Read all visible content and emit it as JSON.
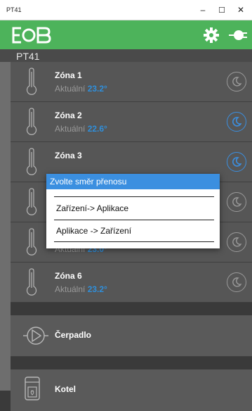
{
  "window": {
    "title": "PT41",
    "minimize": "–",
    "maximize": "☐",
    "close": "✕"
  },
  "header": {
    "logo_icon": "ebb-logo",
    "settings_icon": "gear-icon",
    "connect_icon": "plug-icon"
  },
  "subheader": {
    "title": "PT41"
  },
  "zones": [
    {
      "name": "Zóna 1",
      "label": "Aktuální",
      "temp": "23.2°",
      "mode_icon": "moon-icon",
      "active": false
    },
    {
      "name": "Zóna 2",
      "label": "Aktuální",
      "temp": "22.6°",
      "mode_icon": "moon-icon",
      "active": true
    },
    {
      "name": "Zóna 3",
      "label": "",
      "temp": "",
      "mode_icon": "moon-icon",
      "active": true
    },
    {
      "name": "",
      "label": "",
      "temp": "",
      "mode_icon": "moon-icon",
      "active": false
    },
    {
      "name": "",
      "label": "Aktuální",
      "temp": "23.0°",
      "mode_icon": "moon-icon",
      "active": false
    },
    {
      "name": "Zóna 6",
      "label": "Aktuální",
      "temp": "23.2°",
      "mode_icon": "moon-icon",
      "active": false
    }
  ],
  "devices": {
    "pump": {
      "label": "Čerpadlo",
      "icon": "pump-icon"
    },
    "boiler": {
      "label": "Kotel",
      "icon": "boiler-icon"
    }
  },
  "dialog": {
    "title": "Zvolte směr přenosu",
    "option1": "Zařízení-> Aplikace",
    "option2": "Aplikace -> Zařízení"
  },
  "colors": {
    "accent_green": "#4db35b",
    "accent_blue": "#3b8fe0",
    "temp_blue": "#2f8fdb"
  }
}
